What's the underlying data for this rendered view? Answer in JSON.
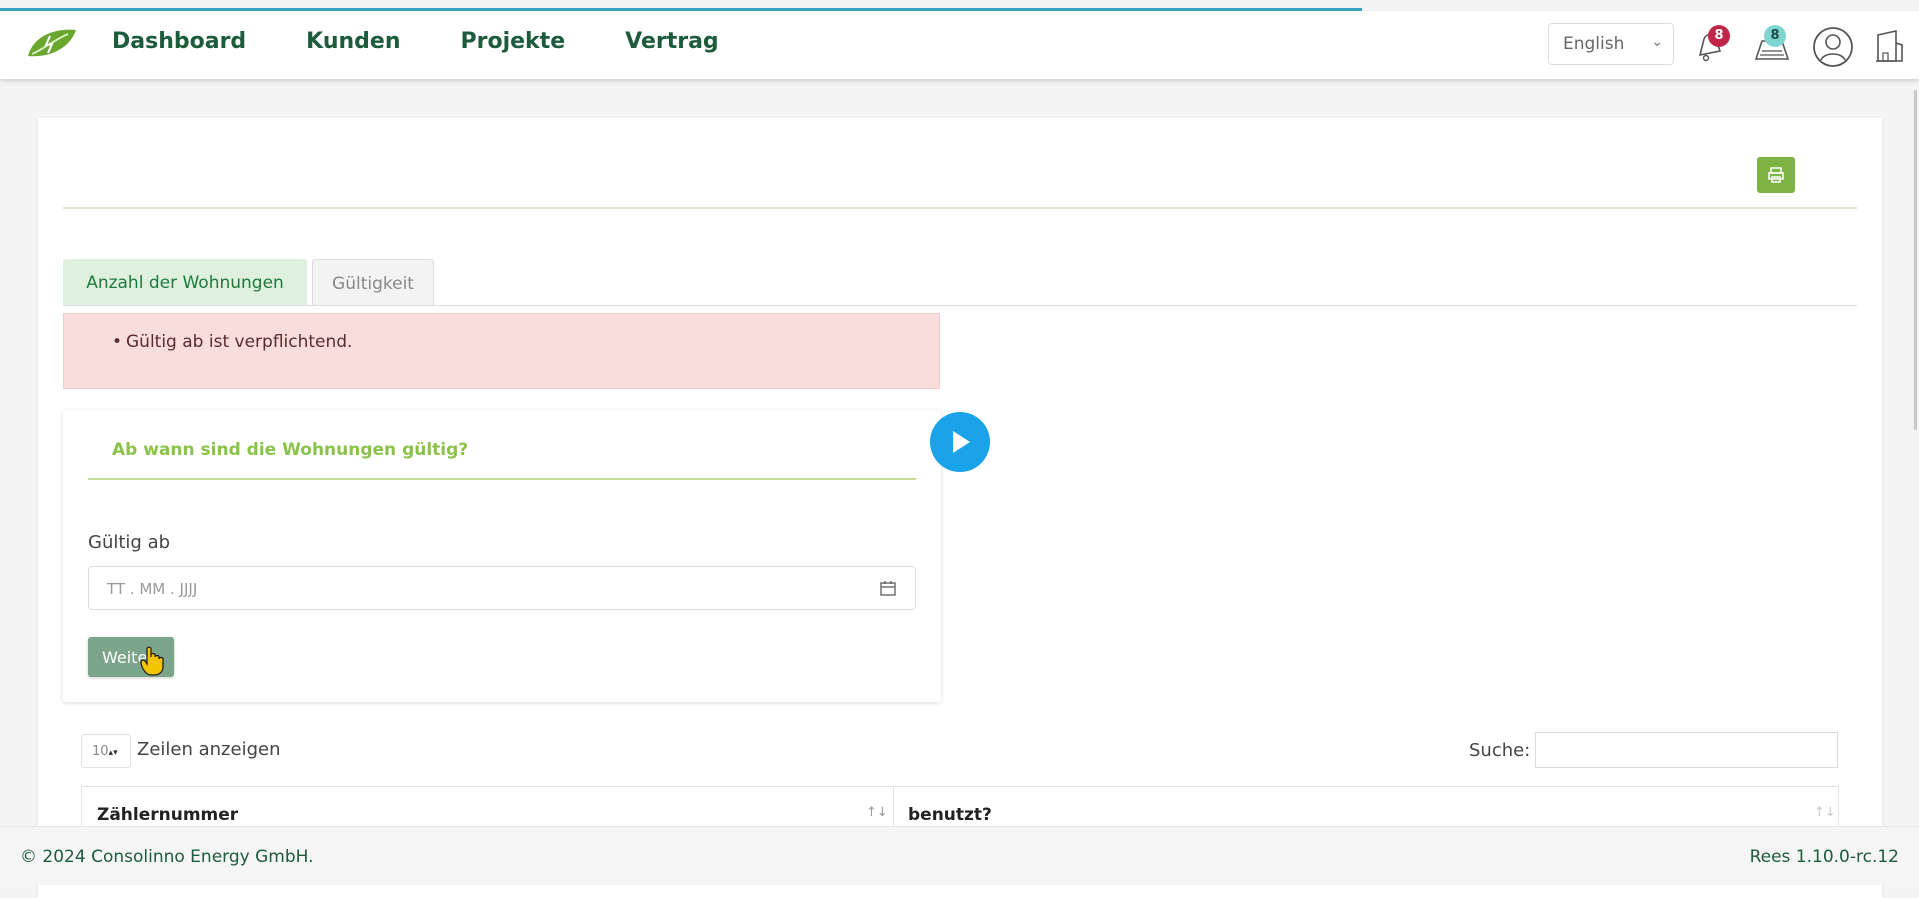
{
  "nav": {
    "items": [
      {
        "label": "Dashboard"
      },
      {
        "label": "Kunden"
      },
      {
        "label": "Projekte"
      },
      {
        "label": "Vertrag"
      }
    ]
  },
  "header": {
    "language": "English",
    "notifications_count": "8",
    "messages_count": "8"
  },
  "tabs": [
    {
      "label": "Anzahl der Wohnungen"
    },
    {
      "label": "Gültigkeit"
    }
  ],
  "alert": {
    "message": "Gültig ab ist verpflichtend."
  },
  "form": {
    "title": "Ab wann sind die Wohnungen gültig?",
    "date_label": "Gültig ab",
    "date_placeholder": "TT . MM . JJJJ",
    "submit_label": "Weiter"
  },
  "table": {
    "page_length": "10",
    "length_label": "Zeilen anzeigen",
    "search_label": "Suche:",
    "columns": [
      {
        "label": "Zählernummer"
      },
      {
        "label": "benutzt?"
      }
    ]
  },
  "footer": {
    "copyright": "© 2024 Consolinno Energy GmbH.",
    "version": "Rees 1.10.0-rc.12"
  },
  "colors": {
    "brand_dark_green": "#1c5b3b",
    "accent_green": "#8bc34a",
    "alert_bg": "#f9dddd",
    "badge_red": "#c0264a",
    "badge_teal": "#7fd6d0",
    "play_blue": "#1aa3e8"
  }
}
